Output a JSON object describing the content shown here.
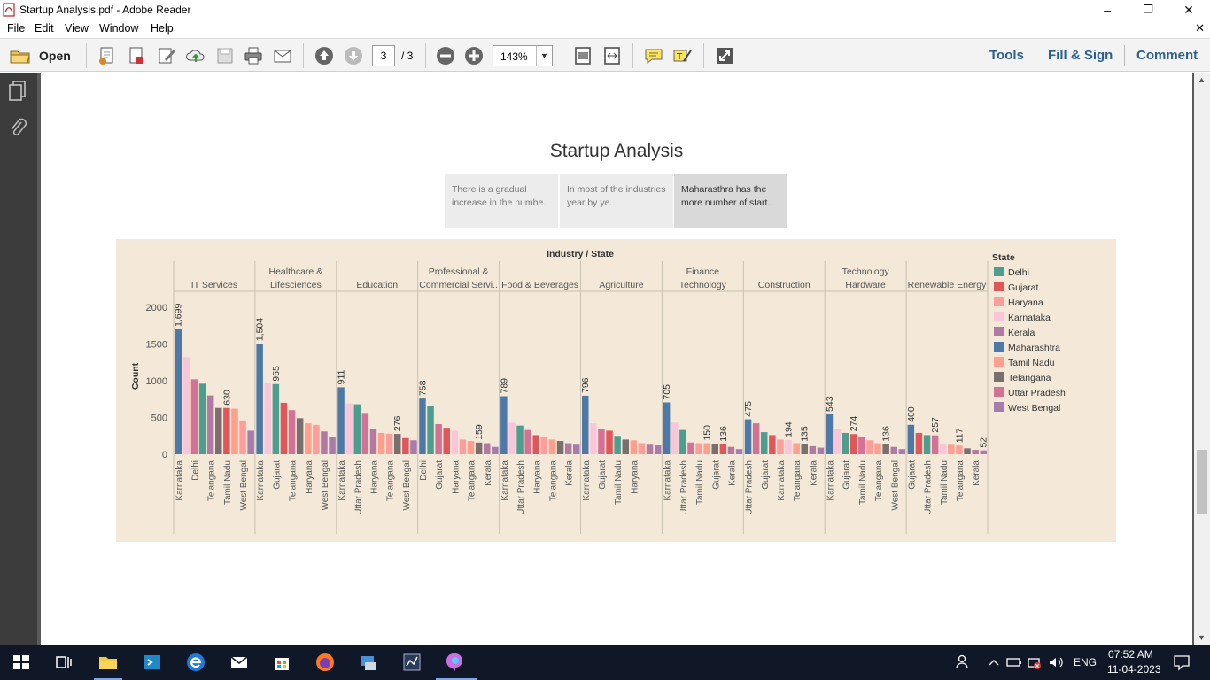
{
  "window": {
    "title": "Startup Analysis.pdf - Adobe Reader",
    "minimize_glyph": "–",
    "restore_glyph": "❐",
    "close_glyph": "✕"
  },
  "menu": {
    "items": [
      "File",
      "Edit",
      "View",
      "Window",
      "Help"
    ],
    "close_doc": "✕"
  },
  "toolbar": {
    "open_label": "Open",
    "page_current": "3",
    "page_total": "/ 3",
    "zoom": "143%",
    "right_tools": [
      "Tools",
      "Fill & Sign",
      "Comment"
    ]
  },
  "story": {
    "title": "Startup Analysis",
    "points": [
      "There is a gradual increase in the numbe..",
      "In most of the industries year by ye..",
      "Maharasthra has the more number of start.."
    ],
    "active_point": 2
  },
  "chart_data": {
    "type": "bar",
    "header": "Industry / State",
    "ylabel": "Count",
    "yticks": [
      2000,
      1500,
      1000,
      500,
      0
    ],
    "ylim": [
      0,
      2100
    ],
    "legend_title": "State",
    "legend": [
      {
        "name": "Delhi",
        "color": "#4e9e8f"
      },
      {
        "name": "Gujarat",
        "color": "#e15759"
      },
      {
        "name": "Haryana",
        "color": "#ff9d9a"
      },
      {
        "name": "Karnataka",
        "color": "#f8c6d8"
      },
      {
        "name": "Kerala",
        "color": "#b07aa1"
      },
      {
        "name": "Maharashtra",
        "color": "#4e79a7"
      },
      {
        "name": "Tamil Nadu",
        "color": "#ff9f8c"
      },
      {
        "name": "Telangana",
        "color": "#79706e"
      },
      {
        "name": "Uttar Pradesh",
        "color": "#d37295"
      },
      {
        "name": "West Bengal",
        "color": "#a77bab"
      }
    ],
    "industries": [
      {
        "name": [
          "IT Services"
        ],
        "bars": [
          {
            "state": "Maharashtra",
            "value": 1699,
            "label": "1,699"
          },
          {
            "state": "Karnataka",
            "value": 1320
          },
          {
            "state": "Uttar Pradesh",
            "value": 1020
          },
          {
            "state": "Delhi",
            "value": 960
          },
          {
            "state": "Kerala",
            "value": 800
          },
          {
            "state": "Telangana",
            "value": 630
          },
          {
            "state": "Gujarat",
            "value": 630,
            "label": "630"
          },
          {
            "state": "Tamil Nadu",
            "value": 620
          },
          {
            "state": "Haryana",
            "value": 460
          },
          {
            "state": "West Bengal",
            "value": 320
          }
        ],
        "ticks": [
          "Karnataka",
          "Delhi",
          "Telangana",
          "Tamil Nadu",
          "West Bengal"
        ]
      },
      {
        "name": [
          "Healthcare &",
          "Lifesciences"
        ],
        "bars": [
          {
            "state": "Maharashtra",
            "value": 1504,
            "label": "1,504"
          },
          {
            "state": "Karnataka",
            "value": 970
          },
          {
            "state": "Delhi",
            "value": 955,
            "label": "955"
          },
          {
            "state": "Gujarat",
            "value": 700
          },
          {
            "state": "Uttar Pradesh",
            "value": 600
          },
          {
            "state": "Telangana",
            "value": 490
          },
          {
            "state": "Tamil Nadu",
            "value": 420
          },
          {
            "state": "Haryana",
            "value": 400
          },
          {
            "state": "Kerala",
            "value": 310
          },
          {
            "state": "West Bengal",
            "value": 240
          }
        ],
        "ticks": [
          "Karnataka",
          "Gujarat",
          "Telangana",
          "Haryana",
          "West Bengal"
        ]
      },
      {
        "name": [
          "Education"
        ],
        "bars": [
          {
            "state": "Maharashtra",
            "value": 911,
            "label": "911"
          },
          {
            "state": "Karnataka",
            "value": 690
          },
          {
            "state": "Delhi",
            "value": 680
          },
          {
            "state": "Uttar Pradesh",
            "value": 550
          },
          {
            "state": "Kerala",
            "value": 340
          },
          {
            "state": "Tamil Nadu",
            "value": 290
          },
          {
            "state": "Haryana",
            "value": 280
          },
          {
            "state": "Telangana",
            "value": 276,
            "label": "276"
          },
          {
            "state": "Gujarat",
            "value": 220
          },
          {
            "state": "West Bengal",
            "value": 190
          }
        ],
        "ticks": [
          "Karnataka",
          "Uttar Pradesh",
          "Haryana",
          "Telangana",
          "West Bengal"
        ]
      },
      {
        "name": [
          "Professional &",
          "Commercial Servi.."
        ],
        "bars": [
          {
            "state": "Maharashtra",
            "value": 758,
            "label": "758"
          },
          {
            "state": "Delhi",
            "value": 660
          },
          {
            "state": "Uttar Pradesh",
            "value": 410
          },
          {
            "state": "Gujarat",
            "value": 360
          },
          {
            "state": "Karnataka",
            "value": 320
          },
          {
            "state": "Haryana",
            "value": 200
          },
          {
            "state": "Tamil Nadu",
            "value": 180
          },
          {
            "state": "Telangana",
            "value": 159,
            "label": "159"
          },
          {
            "state": "Kerala",
            "value": 150
          },
          {
            "state": "West Bengal",
            "value": 100
          }
        ],
        "ticks": [
          "Delhi",
          "Gujarat",
          "Haryana",
          "Telangana",
          "Kerala"
        ]
      },
      {
        "name": [
          "Food & Beverages"
        ],
        "bars": [
          {
            "state": "Maharashtra",
            "value": 789,
            "label": "789"
          },
          {
            "state": "Karnataka",
            "value": 430
          },
          {
            "state": "Delhi",
            "value": 390
          },
          {
            "state": "Uttar Pradesh",
            "value": 330
          },
          {
            "state": "Gujarat",
            "value": 260
          },
          {
            "state": "Haryana",
            "value": 230
          },
          {
            "state": "Tamil Nadu",
            "value": 200
          },
          {
            "state": "Telangana",
            "value": 180
          },
          {
            "state": "Kerala",
            "value": 150
          },
          {
            "state": "West Bengal",
            "value": 130
          }
        ],
        "ticks": [
          "Karnataka",
          "Uttar Pradesh",
          "Haryana",
          "Telangana",
          "Kerala"
        ]
      },
      {
        "name": [
          "Agriculture"
        ],
        "bars": [
          {
            "state": "Maharashtra",
            "value": 796,
            "label": "796"
          },
          {
            "state": "Karnataka",
            "value": 420
          },
          {
            "state": "Uttar Pradesh",
            "value": 350
          },
          {
            "state": "Gujarat",
            "value": 320
          },
          {
            "state": "Delhi",
            "value": 250
          },
          {
            "state": "Telangana",
            "value": 200
          },
          {
            "state": "Tamil Nadu",
            "value": 190
          },
          {
            "state": "Haryana",
            "value": 150
          },
          {
            "state": "Kerala",
            "value": 130
          },
          {
            "state": "West Bengal",
            "value": 120
          }
        ],
        "ticks": [
          "Karnataka",
          "Gujarat",
          "Tamil Nadu",
          "Haryana"
        ]
      },
      {
        "name": [
          "Finance",
          "Technology"
        ],
        "bars": [
          {
            "state": "Maharashtra",
            "value": 705,
            "label": "705"
          },
          {
            "state": "Karnataka",
            "value": 430
          },
          {
            "state": "Delhi",
            "value": 330
          },
          {
            "state": "Uttar Pradesh",
            "value": 160
          },
          {
            "state": "Haryana",
            "value": 150
          },
          {
            "state": "Tamil Nadu",
            "value": 150,
            "label": "150"
          },
          {
            "state": "Telangana",
            "value": 140
          },
          {
            "state": "Gujarat",
            "value": 136,
            "label": "136"
          },
          {
            "state": "Kerala",
            "value": 100
          },
          {
            "state": "West Bengal",
            "value": 70
          }
        ],
        "ticks": [
          "Karnataka",
          "Uttar Pradesh",
          "Tamil Nadu",
          "Gujarat",
          "Kerala"
        ]
      },
      {
        "name": [
          "Construction"
        ],
        "bars": [
          {
            "state": "Maharashtra",
            "value": 475,
            "label": "475"
          },
          {
            "state": "Uttar Pradesh",
            "value": 420
          },
          {
            "state": "Delhi",
            "value": 300
          },
          {
            "state": "Gujarat",
            "value": 260
          },
          {
            "state": "Haryana",
            "value": 200
          },
          {
            "state": "Karnataka",
            "value": 194,
            "label": "194"
          },
          {
            "state": "Tamil Nadu",
            "value": 150
          },
          {
            "state": "Telangana",
            "value": 135,
            "label": "135"
          },
          {
            "state": "Kerala",
            "value": 110
          },
          {
            "state": "West Bengal",
            "value": 90
          }
        ],
        "ticks": [
          "Uttar Pradesh",
          "Gujarat",
          "Karnataka",
          "Telangana",
          "Kerala"
        ]
      },
      {
        "name": [
          "Technology",
          "Hardware"
        ],
        "bars": [
          {
            "state": "Maharashtra",
            "value": 543,
            "label": "543"
          },
          {
            "state": "Karnataka",
            "value": 340
          },
          {
            "state": "Delhi",
            "value": 290
          },
          {
            "state": "Gujarat",
            "value": 274,
            "label": "274"
          },
          {
            "state": "Uttar Pradesh",
            "value": 230
          },
          {
            "state": "Haryana",
            "value": 190
          },
          {
            "state": "Tamil Nadu",
            "value": 150
          },
          {
            "state": "Telangana",
            "value": 136,
            "label": "136"
          },
          {
            "state": "Kerala",
            "value": 100
          },
          {
            "state": "West Bengal",
            "value": 70
          }
        ],
        "ticks": [
          "Karnataka",
          "Gujarat",
          "Tamil Nadu",
          "Telangana",
          "West Bengal"
        ]
      },
      {
        "name": [
          "Renewable Energy"
        ],
        "bars": [
          {
            "state": "Maharashtra",
            "value": 400,
            "label": "400"
          },
          {
            "state": "Gujarat",
            "value": 290
          },
          {
            "state": "Delhi",
            "value": 260
          },
          {
            "state": "Uttar Pradesh",
            "value": 257,
            "label": "257"
          },
          {
            "state": "Karnataka",
            "value": 140
          },
          {
            "state": "Tamil Nadu",
            "value": 130
          },
          {
            "state": "Haryana",
            "value": 117,
            "label": "117"
          },
          {
            "state": "Telangana",
            "value": 80
          },
          {
            "state": "Kerala",
            "value": 60
          },
          {
            "state": "West Bengal",
            "value": 52,
            "label": "52"
          }
        ],
        "ticks": [
          "Gujarat",
          "Uttar Pradesh",
          "Tamil Nadu",
          "Telangana",
          "Kerala"
        ]
      }
    ]
  },
  "taskbar": {
    "language": "ENG",
    "time": "07:52 AM",
    "date": "11-04-2023"
  }
}
